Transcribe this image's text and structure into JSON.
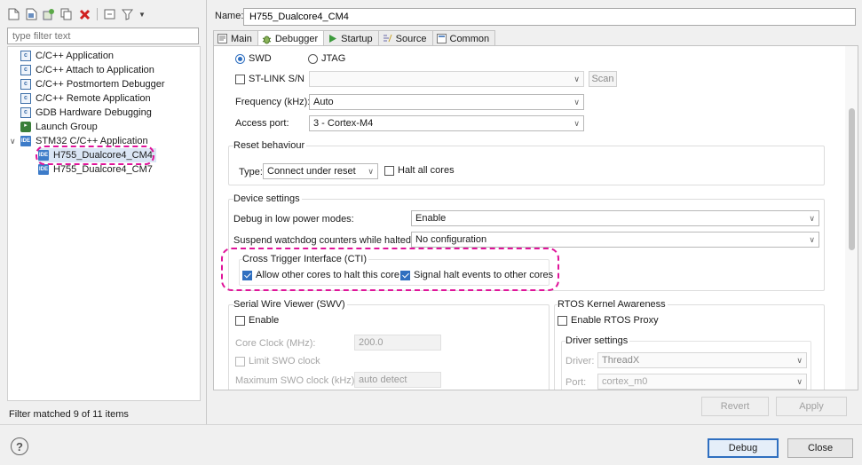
{
  "left": {
    "filter_placeholder": "type filter text",
    "tree": [
      {
        "label": "C/C++ Application",
        "icon": "c-icon"
      },
      {
        "label": "C/C++ Attach to Application",
        "icon": "c-icon"
      },
      {
        "label": "C/C++ Postmortem Debugger",
        "icon": "c-icon"
      },
      {
        "label": "C/C++ Remote Application",
        "icon": "c-icon"
      },
      {
        "label": "GDB Hardware Debugging",
        "icon": "c-icon"
      },
      {
        "label": "Launch Group",
        "icon": "launch-group-icon"
      },
      {
        "label": "STM32 C/C++ Application",
        "icon": "ide-icon",
        "expanded": true
      },
      {
        "label": "H755_Dualcore4_CM4",
        "icon": "ide-icon",
        "selected": true
      },
      {
        "label": "H755_Dualcore4_CM7",
        "icon": "ide-icon"
      }
    ],
    "status": "Filter matched 9 of 11 items"
  },
  "name_label": "Name:",
  "name_value": "H755_Dualcore4_CM4",
  "tabs": [
    {
      "label": "Main"
    },
    {
      "label": "Debugger",
      "active": true
    },
    {
      "label": "Startup"
    },
    {
      "label": "Source"
    },
    {
      "label": "Common"
    }
  ],
  "debugger": {
    "swd": "SWD",
    "jtag": "JTAG",
    "stlink_sn": "ST-LINK S/N",
    "scan": "Scan",
    "frequency_label": "Frequency (kHz):",
    "frequency_value": "Auto",
    "access_port_label": "Access port:",
    "access_port_value": "3 - Cortex-M4",
    "reset_title": "Reset behaviour",
    "reset_type_label": "Type:",
    "reset_type_value": "Connect under reset",
    "halt_all_cores": "Halt all cores",
    "device_title": "Device settings",
    "low_power_label": "Debug in low power modes:",
    "low_power_value": "Enable",
    "watchdog_label": "Suspend watchdog counters while halted:",
    "watchdog_value": "No configuration",
    "cti_title": "Cross Trigger Interface (CTI)",
    "cti_allow": "Allow other cores to halt this core",
    "cti_signal": "Signal halt events to other cores",
    "swv_title": "Serial Wire Viewer (SWV)",
    "swv_enable": "Enable",
    "core_clock_label": "Core Clock (MHz):",
    "core_clock_value": "200.0",
    "limit_swo": "Limit SWO clock",
    "max_swo_label": "Maximum SWO clock (kHz):",
    "max_swo_value": "auto detect",
    "rtos_title": "RTOS Kernel Awareness",
    "rtos_enable": "Enable RTOS Proxy",
    "driver_settings": "Driver settings",
    "driver_label": "Driver:",
    "driver_value": "ThreadX",
    "port_label": "Port:",
    "port_value": "cortex_m0"
  },
  "buttons": {
    "revert": "Revert",
    "apply": "Apply",
    "debug": "Debug",
    "close": "Close",
    "help": "?"
  },
  "colors": {
    "highlight": "#e0149a",
    "accent": "#2f6fc0"
  }
}
